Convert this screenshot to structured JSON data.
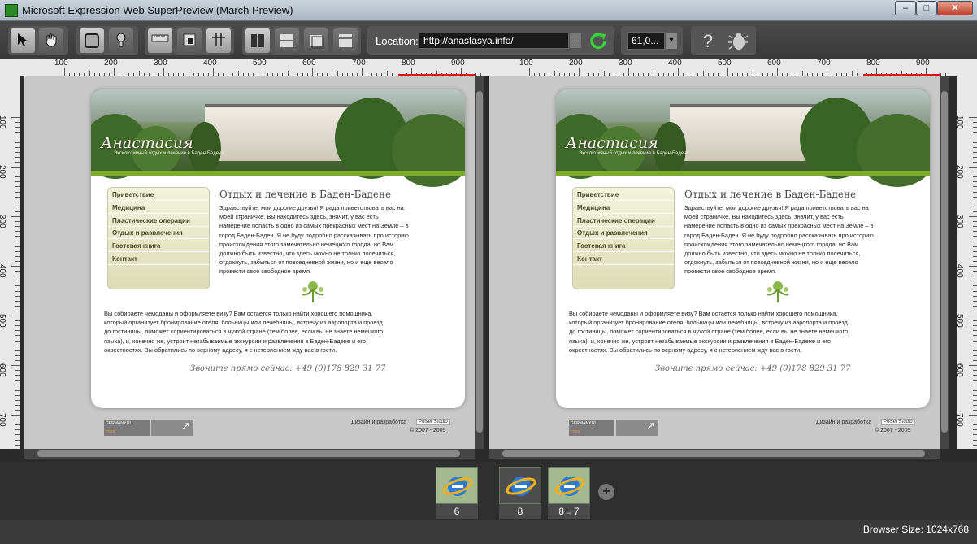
{
  "window": {
    "title": "Microsoft Expression Web SuperPreview (March Preview)",
    "minimize": "–",
    "maximize": "□",
    "close": "✕"
  },
  "toolbar": {
    "location_label": "Location:",
    "url": "http://anastasya.info/",
    "url_more": "...",
    "zoom": "61,0...",
    "zoom_dropdown": "▾",
    "help": "?"
  },
  "rulers": {
    "h_labels": [
      "100",
      "200",
      "300",
      "400",
      "500",
      "600",
      "700",
      "800",
      "900"
    ],
    "v_labels": [
      "100",
      "200",
      "300",
      "400",
      "500",
      "600",
      "700"
    ]
  },
  "page": {
    "logo": "Анастасия",
    "slogan": "Эксклюзивный отдых и лечение в Баден-Бадене",
    "menu": [
      "Приветствие",
      "Медицина",
      "Пластические операции",
      "Отдых и развлечения",
      "Гостевая книга",
      "Контакт"
    ],
    "heading": "Отдых и лечение в Баден-Бадене",
    "intro_lines": [
      "Здравствуйте, мои дорогие друзья! Я рада приветствовать вас на",
      "моей страничке. Вы находитесь здесь, значит, у вас есть",
      "намерение попасть в одно из самых прекрасных мест на Земле – в",
      "город Баден-Баден. Я не буду подробно рассказывать про историю",
      "происхождения этого замечательно немецкого города, но Вам",
      "должно быть известно, что здесь можно не только полечиться,",
      "отдохнуть, забыться от повседневной жизни, но и еще весело",
      "провести свое свободное время."
    ],
    "body_lines": [
      "Вы собираете чемоданы и оформляете визу? Вам остается только найти хорошего помощника,",
      "который организует бронирование отеля, больницы или лечебницы, встречу из аэропорта и проезд",
      "до гостиницы, поможет сориентироваться в чужой стране (тем более, если вы не знаете немецкого",
      "языка), и, конечно же, устроит незабываемые экскурсии и развлечения в Баден-Бадене и его",
      "окрестностях. Вы обратились по верному адресу, я с нетерпением жду вас в гости."
    ],
    "phone": "Звоните прямо сейчас: +49 (0)178 829 31 77",
    "badge_germany": "GERMANY.RU",
    "badge_year": "2008",
    "design_credit": "Дизайн и разработка",
    "studio": "Polser Studio",
    "copyright": "© 2007 - 2009"
  },
  "browsers": [
    {
      "version": "6"
    },
    {
      "version": "8"
    },
    {
      "version": "8→7"
    }
  ],
  "add_browser": "+",
  "status": {
    "browser_size": "Browser Size: 1024x768"
  }
}
